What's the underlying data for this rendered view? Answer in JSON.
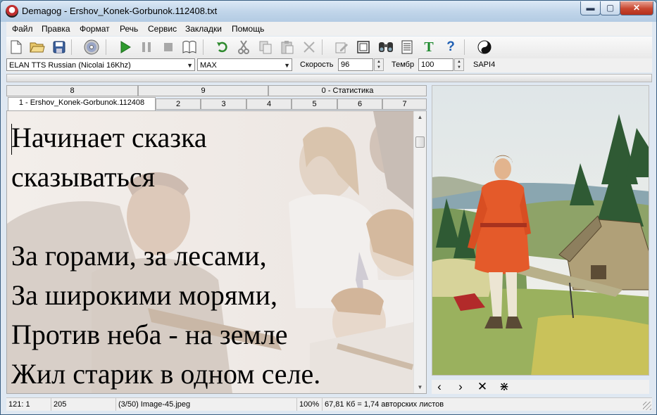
{
  "window": {
    "title": "Demagog - Ershov_Konek-Gorbunok.112408.txt"
  },
  "window_controls": {
    "minimize": "▬",
    "maximize": "▢",
    "close": "✕"
  },
  "menu": [
    "Файл",
    "Правка",
    "Формат",
    "Речь",
    "Сервис",
    "Закладки",
    "Помощь"
  ],
  "toolbar": {
    "icons": [
      "new-file-icon",
      "open-folder-icon",
      "save-icon",
      "cd-icon",
      "play-icon",
      "pause-icon",
      "stop-icon",
      "book-icon",
      "undo-icon",
      "cut-icon",
      "copy-icon",
      "paste-icon",
      "delete-icon",
      "edit-icon",
      "frame-icon",
      "find-icon",
      "document-icon",
      "text-icon",
      "help-icon",
      "yin-yang-icon"
    ]
  },
  "voice": {
    "engine": "ELAN TTS Russian (Nicolai 16Khz)",
    "preset": "MAX",
    "speed_label": "Скорость",
    "speed_value": "96",
    "timbre_label": "Тембр",
    "timbre_value": "100",
    "api": "SAPI4"
  },
  "progress": 0,
  "tabs_row1": [
    "8",
    "9",
    "0 - Статистика"
  ],
  "tabs_row2": [
    "1 - Ershov_Konek-Gorbunok.112408",
    "2",
    "3",
    "4",
    "5",
    "6",
    "7"
  ],
  "editor": {
    "lines": [
      "Начинает сказка",
      "сказываться",
      "",
      "За горами, за лесами,",
      "За широкими морями,",
      "Против неба - на земле",
      "Жил старик в одном селе."
    ]
  },
  "image_nav": {
    "prev": "‹",
    "next": "›",
    "delete": "✕",
    "delete_all": "⋇"
  },
  "status": {
    "position": "121: 1",
    "count": "205",
    "image": "(3/50) Image-45.jpeg",
    "zoom": "100%",
    "size": "67,81 Кб = 1,74 авторских листов"
  },
  "colors": {
    "accent_green": "#2e9a2e",
    "title_bar": "#c2d6ea",
    "close_red": "#c8462f"
  }
}
